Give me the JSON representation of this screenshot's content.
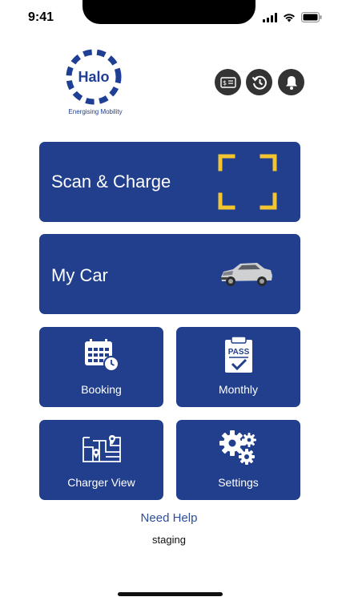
{
  "status_bar": {
    "time": "9:41",
    "icons": [
      "signal-icon",
      "wifi-icon",
      "battery-icon"
    ]
  },
  "brand": {
    "name": "Halo",
    "tagline": "Energising Mobility",
    "color": "#1e3f94"
  },
  "header_actions": [
    {
      "icon": "bill-icon"
    },
    {
      "icon": "history-icon"
    },
    {
      "icon": "bell-icon"
    }
  ],
  "tiles": {
    "scan_charge": {
      "label": "Scan & Charge",
      "icon": "scan-frame-icon"
    },
    "my_car": {
      "label": "My Car",
      "icon": "car-image"
    },
    "booking": {
      "label": "Booking",
      "icon": "calendar-clock-icon"
    },
    "monthly": {
      "label": "Monthly",
      "icon": "pass-icon",
      "icon_text": "PASS"
    },
    "charger_view": {
      "label": "Charger View",
      "icon": "map-icon"
    },
    "settings": {
      "label": "Settings",
      "icon": "gears-icon"
    }
  },
  "footer": {
    "help_label": "Need Help",
    "environment": "staging"
  },
  "colors": {
    "tile_bg": "#213f8c",
    "accent_yellow": "#f3c530",
    "link": "#2c4f97"
  }
}
